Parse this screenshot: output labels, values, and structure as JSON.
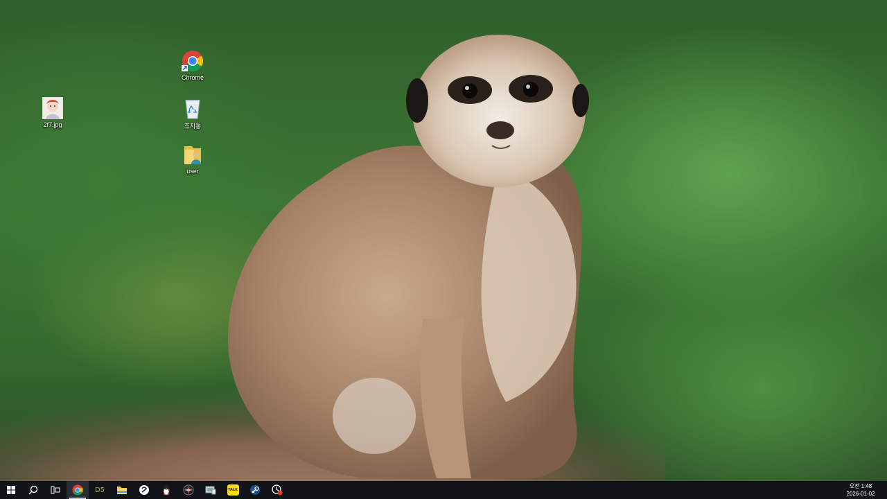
{
  "desktop": {
    "icons": [
      {
        "name": "chrome",
        "label": "Chrome",
        "icon": "chrome-icon"
      },
      {
        "name": "image-file",
        "label": "2f7.jpg",
        "icon": "image-thumbnail-icon"
      },
      {
        "name": "recycle-bin",
        "label": "휴지통",
        "icon": "recycle-bin-icon"
      },
      {
        "name": "user-folder",
        "label": "user",
        "icon": "user-folder-icon"
      }
    ]
  },
  "taskbar": {
    "start": {
      "icon": "windows-start-icon"
    },
    "search": {
      "icon": "search-icon"
    },
    "task_view": {
      "icon": "task-view-icon"
    },
    "apps": [
      {
        "name": "chrome",
        "icon": "chrome-icon",
        "active": true,
        "text": ""
      },
      {
        "name": "ds",
        "icon": "ds-app-icon",
        "text": "D5"
      },
      {
        "name": "file-explorer",
        "icon": "folder-icon",
        "text": ""
      },
      {
        "name": "app-circle",
        "icon": "app-circle-icon",
        "text": ""
      },
      {
        "name": "penguin-app",
        "icon": "penguin-icon",
        "text": ""
      },
      {
        "name": "red-compass-app",
        "icon": "compass-icon",
        "text": ""
      },
      {
        "name": "device-app",
        "icon": "device-icon",
        "text": ""
      },
      {
        "name": "kakaotalk",
        "icon": "talk-icon",
        "text": "TALK"
      },
      {
        "name": "steam",
        "icon": "steam-icon",
        "text": ""
      },
      {
        "name": "record-app",
        "icon": "record-icon",
        "text": ""
      }
    ],
    "clock": {
      "time": "오전 1:48",
      "date": "2026-01-02"
    }
  },
  "colors": {
    "taskbar_bg": "#101418",
    "chrome_red": "#db4437",
    "chrome_yellow": "#f4c20d",
    "chrome_green": "#0f9d58",
    "chrome_blue": "#4285f4",
    "kakao_yellow": "#f9e000"
  }
}
